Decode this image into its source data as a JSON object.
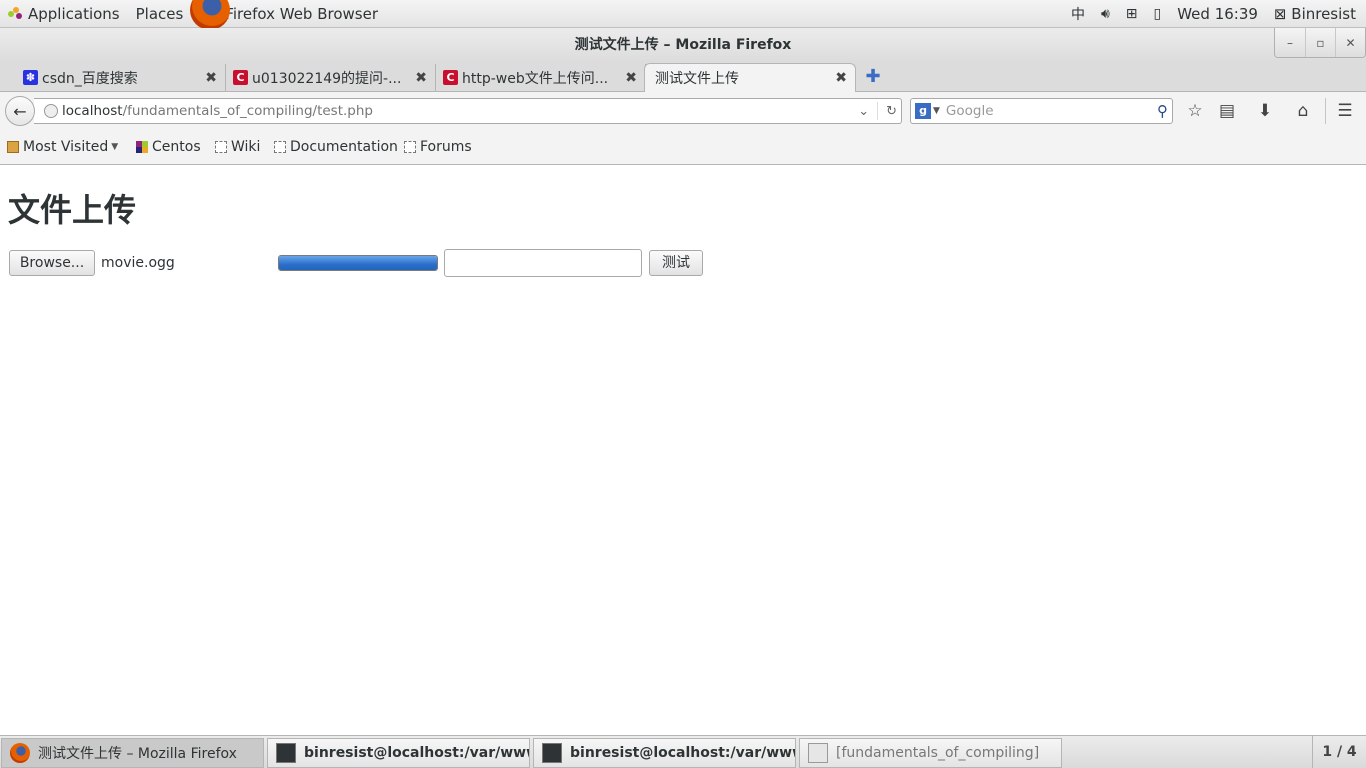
{
  "top_panel": {
    "applications_label": "Applications",
    "places_label": "Places",
    "active_app_label": "Firefox Web Browser",
    "input_method": "中",
    "clock": "Wed 16:39",
    "user": "Binresist"
  },
  "window": {
    "title": "测试文件上传 – Mozilla Firefox"
  },
  "tabs": [
    {
      "label": "csdn_百度搜索",
      "favicon_color": "#2932e1",
      "favicon": "paw-icon"
    },
    {
      "label": "u013022149的提问-...",
      "favicon_color": "#c8102e",
      "favicon": "csdn-icon"
    },
    {
      "label": "http-web文件上传问...",
      "favicon_color": "#c8102e",
      "favicon": "csdn-icon"
    },
    {
      "label": "测试文件上传",
      "active": true
    }
  ],
  "navbar": {
    "url_host": "localhost",
    "url_path": "/fundamentals_of_compiling/test.php",
    "search_placeholder": "Google"
  },
  "bookmarks": [
    {
      "label": "Most Visited"
    },
    {
      "label": "Centos"
    },
    {
      "label": "Wiki"
    },
    {
      "label": "Documentation"
    },
    {
      "label": "Forums"
    }
  ],
  "page": {
    "heading": "文件上传",
    "browse_label": "Browse...",
    "file_name": "movie.ogg",
    "progress_percent": 100,
    "text_value": "",
    "test_button_label": "测试"
  },
  "taskbar": {
    "items": [
      {
        "label": "测试文件上传 – Mozilla Firefox"
      },
      {
        "label": "binresist@localhost:/var/www/h..."
      },
      {
        "label": "binresist@localhost:/var/www/h..."
      },
      {
        "label": "[fundamentals_of_compiling]"
      }
    ],
    "workspace": "1 / 4"
  },
  "colors": {
    "accent": "#2a6fcb",
    "csdn_red": "#c8102e"
  }
}
